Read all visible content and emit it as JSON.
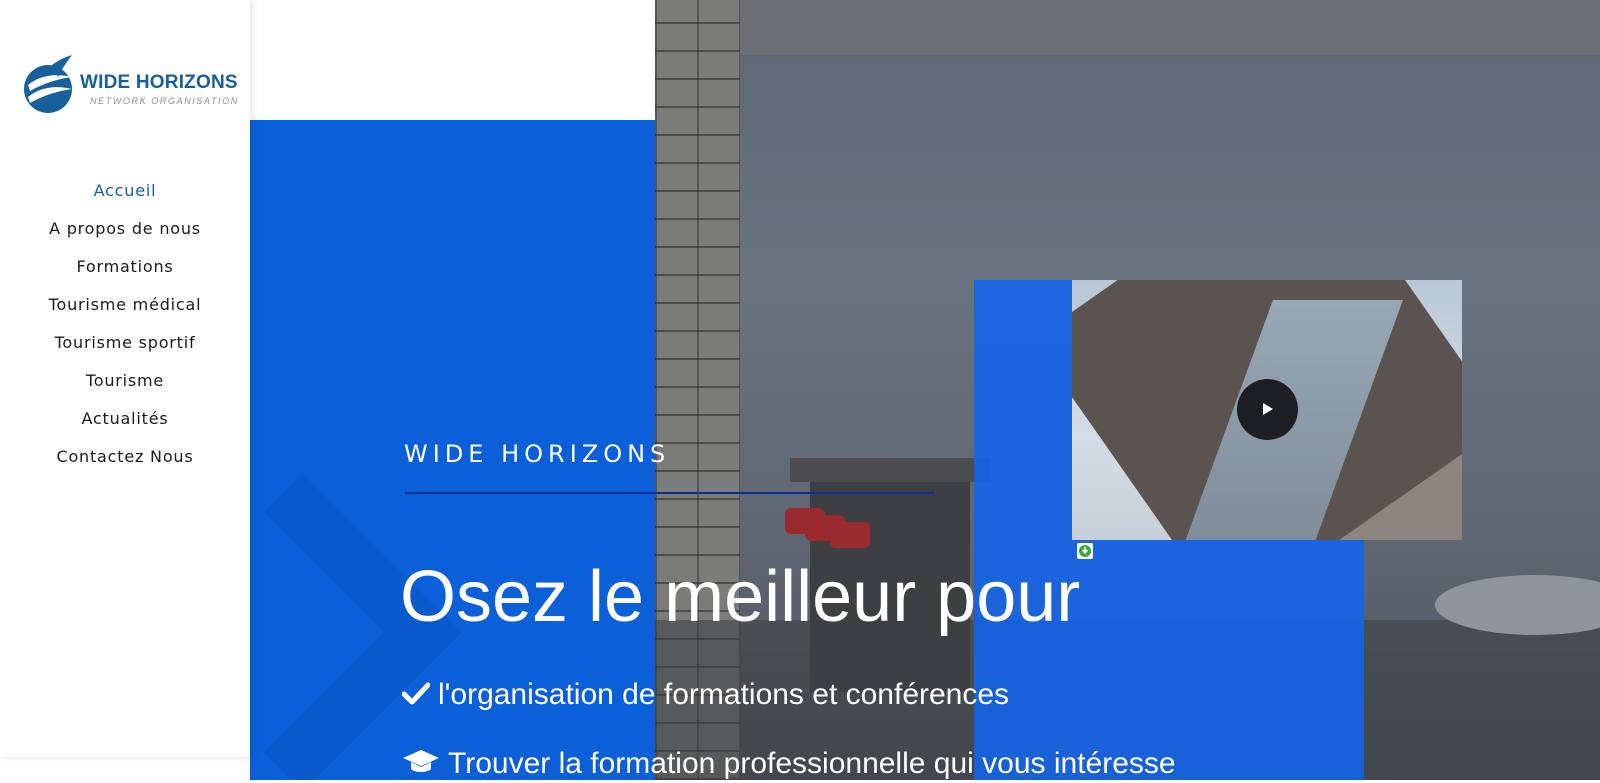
{
  "brand": {
    "title": "WIDE HORIZONS",
    "subtitle": "NETWORK ORGANISATION",
    "primary_color": "#17609b",
    "accent_blue": "#0b5fd9"
  },
  "nav": {
    "items": [
      {
        "label": "Accueil",
        "active": true
      },
      {
        "label": "A propos de nous"
      },
      {
        "label": "Formations"
      },
      {
        "label": "Tourisme médical"
      },
      {
        "label": "Tourisme sportif"
      },
      {
        "label": "Tourisme"
      },
      {
        "label": "Actualités"
      },
      {
        "label": "Contactez Nous"
      }
    ]
  },
  "hero": {
    "eyebrow": "WIDE HORIZONS",
    "headline": "Osez le meilleur pour",
    "bullets": [
      {
        "icon": "check-icon",
        "text": "l'organisation de formations et conférences"
      },
      {
        "icon": "graduation-cap-icon",
        "text": "Trouver la formation professionnelle qui vous intéresse"
      }
    ]
  },
  "media": {
    "play_icon": "play-icon",
    "download_icon": "download-icon"
  }
}
